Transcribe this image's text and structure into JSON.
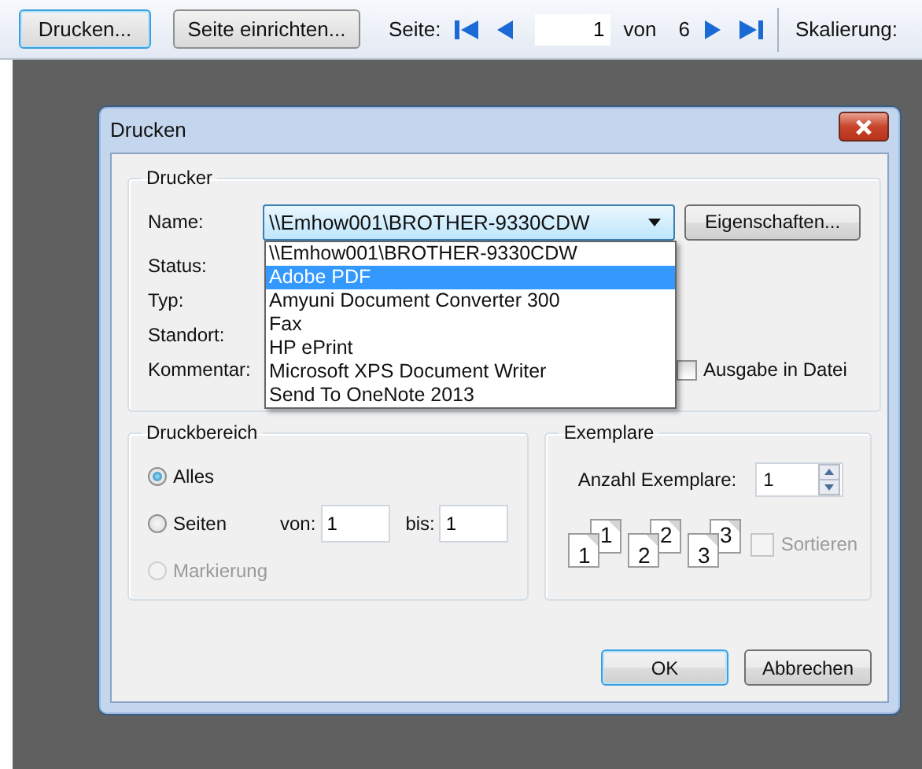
{
  "toolbar": {
    "print_button": "Drucken...",
    "page_setup_button": "Seite einrichten...",
    "page_label": "Seite:",
    "page_value": "1",
    "of_label": "von",
    "page_count": "6",
    "scale_label": "Skalierung:"
  },
  "dialog": {
    "title": "Drucken",
    "printer_group": {
      "title": "Drucker",
      "name_label": "Name:",
      "name_value": "\\\\Emhow001\\BROTHER-9330CDW",
      "properties_button": "Eigenschaften...",
      "info_labels": [
        "Status:",
        "Typ:",
        "Standort:",
        "Kommentar:"
      ],
      "print_to_file": {
        "label": "Ausgabe in Datei",
        "checked": false
      },
      "dropdown": {
        "expanded": true,
        "options": [
          {
            "label": "\\\\Emhow001\\BROTHER-9330CDW",
            "selected": false
          },
          {
            "label": "Adobe PDF",
            "selected": true
          },
          {
            "label": "Amyuni Document Converter 300",
            "selected": false
          },
          {
            "label": "Fax",
            "selected": false
          },
          {
            "label": "HP ePrint",
            "selected": false
          },
          {
            "label": "Microsoft XPS Document Writer",
            "selected": false
          },
          {
            "label": "Send To OneNote 2013",
            "selected": false
          }
        ]
      }
    },
    "range_group": {
      "title": "Druckbereich",
      "options": [
        {
          "label": "Alles",
          "selected": true,
          "disabled": false
        },
        {
          "label": "Seiten",
          "selected": false,
          "disabled": false,
          "from_label": "von:",
          "from_value": "1",
          "to_label": "bis:",
          "to_value": "1"
        },
        {
          "label": "Markierung",
          "selected": false,
          "disabled": true
        }
      ]
    },
    "copies_group": {
      "title": "Exemplare",
      "count_label": "Anzahl Exemplare:",
      "count_value": "1",
      "collate_pages": [
        {
          "front": "1",
          "back": "1"
        },
        {
          "front": "2",
          "back": "2"
        },
        {
          "front": "3",
          "back": "3"
        }
      ],
      "collate": {
        "label": "Sortieren",
        "checked": false,
        "disabled": true
      }
    },
    "buttons": [
      {
        "label": "OK",
        "default": true
      },
      {
        "label": "Abbrechen",
        "default": false
      }
    ]
  }
}
